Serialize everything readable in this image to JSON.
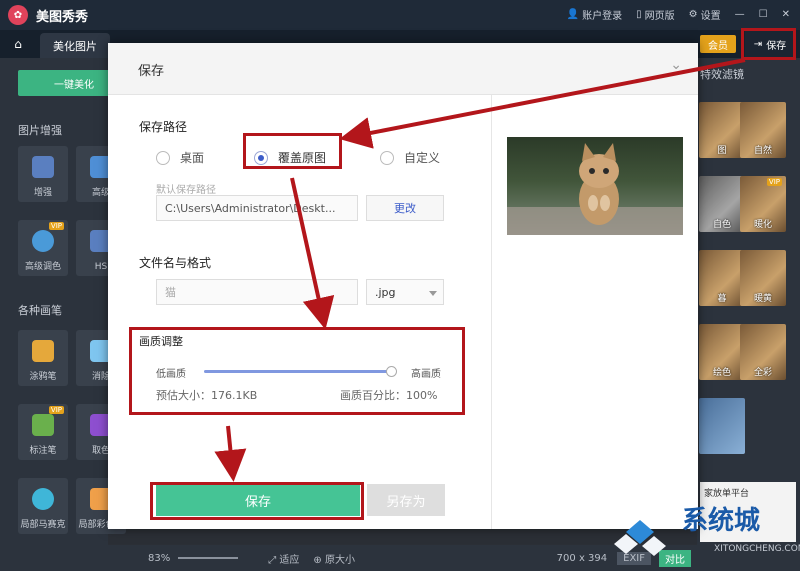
{
  "app": {
    "name": "美图秀秀",
    "logo_glyph": "✿"
  },
  "title_links": [
    "账户登录",
    "网页版",
    "设置"
  ],
  "tabs": {
    "active": "美化图片"
  },
  "header_buttons": {
    "vip": "会员",
    "save": "保存"
  },
  "left_panel": {
    "one_key": "一键美化",
    "section_enhance": "图片增强",
    "section_brush": "各种画笔",
    "tools": [
      "增强",
      "高级",
      "高级调色",
      "HS",
      "涂鸦笔",
      "消除",
      "标注笔",
      "取色",
      "局部马赛克",
      "局部彩色笔"
    ],
    "vip_badge": "VIP"
  },
  "right_panel": {
    "header": "特效滤镜",
    "thumbs": [
      "图",
      "自然",
      "自色",
      "暖化",
      "暮",
      "暖黄",
      "绘色",
      "全彩"
    ],
    "vip_badge": "VIP",
    "promo": "家放单平台"
  },
  "bottom_bar": {
    "zoom": "83%",
    "fit": "适应",
    "original": "原大小",
    "size": "700 x 394",
    "exif": "EXIF",
    "compare": "对比"
  },
  "dialog": {
    "title": "保存",
    "path_label": "保存路径",
    "options": [
      "桌面",
      "覆盖原图",
      "自定义"
    ],
    "selected_index": 1,
    "default_path_label": "默认保存路径",
    "path_value": "C:\\Users\\Administrator\\Deskt...",
    "change_button": "更改",
    "filename_label": "文件名与格式",
    "filename_value": "猫",
    "format_value": ".jpg",
    "quality_label": "画质调整",
    "low_quality": "低画质",
    "high_quality": "高画质",
    "quality_percent": 100,
    "estimate": "预估大小：176.1KB",
    "percent_text": "画质百分比：100%",
    "save_button": "保存",
    "save_as_button": "另存为"
  },
  "watermark": {
    "text": "系统城",
    "url": "XITONGCHENG.COM"
  },
  "colors": {
    "accent_green": "#45c495",
    "annotation_red": "#b3161b",
    "radio_blue": "#3c5cc9"
  }
}
